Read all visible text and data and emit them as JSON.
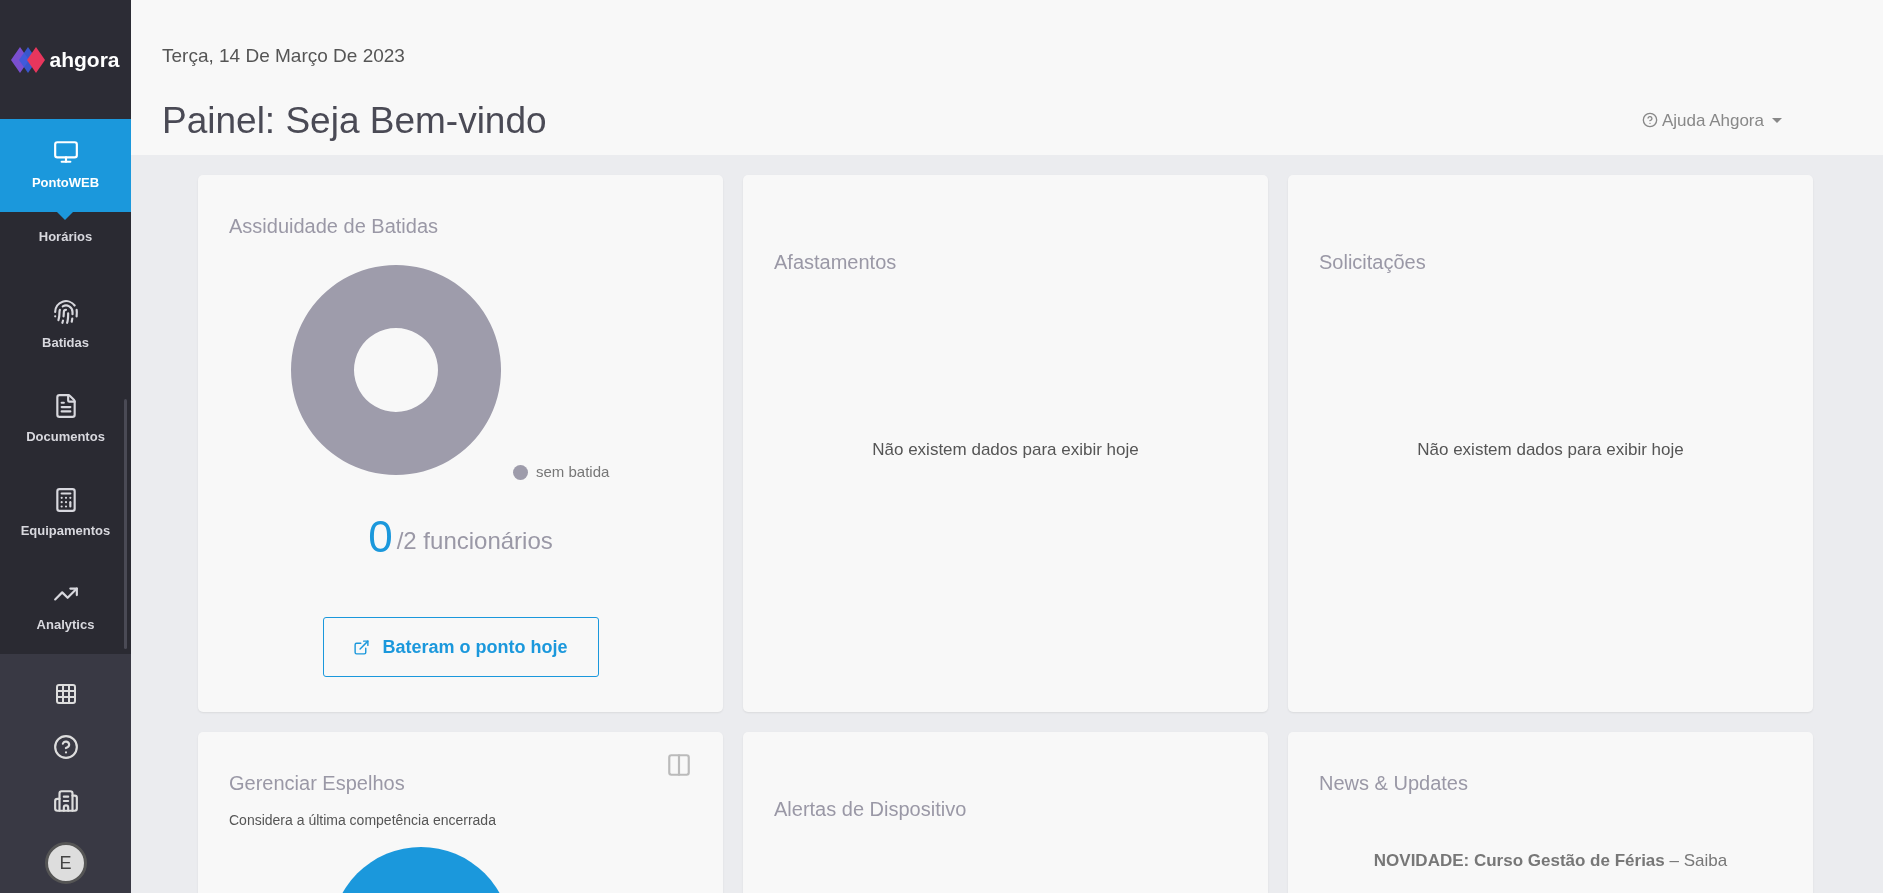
{
  "sidebar": {
    "logo": "ahgora",
    "items": [
      {
        "label": "PontoWEB",
        "selected": true
      },
      {
        "label": "Horários",
        "selected": false
      },
      {
        "label": "Batidas",
        "selected": false
      },
      {
        "label": "Documentos",
        "selected": false
      },
      {
        "label": "Equipamentos",
        "selected": false
      },
      {
        "label": "Analytics",
        "selected": false
      }
    ],
    "avatar": "E"
  },
  "header": {
    "date": "Terça, 14 De Março De 2023",
    "title": "Painel: Seja Bem-vindo",
    "help": "Ajuda Ahgora"
  },
  "cards": [
    {
      "kind": "attendance",
      "title": "Assiduidade de Batidas",
      "legend": {
        "label": "sem batida",
        "color": "#9e9cab"
      },
      "count": "0",
      "total": "/2 funcionários",
      "button": "Bateram o ponto hoje"
    },
    {
      "kind": "empty",
      "title": "Afastamentos",
      "message": "Não existem dados para exibir hoje"
    },
    {
      "kind": "empty",
      "title": "Solicitações",
      "message": "Não existem dados para exibir hoje"
    },
    {
      "kind": "mirrors",
      "title": "Gerenciar Espelhos",
      "subtitle": "Considera a última competência encerrada"
    },
    {
      "kind": "alerts",
      "title": "Alertas de Dispositivo"
    },
    {
      "kind": "news",
      "title": "News & Updates",
      "news": "**NOVIDADE: Curso Gestão de Férias** – Saiba"
    }
  ]
}
